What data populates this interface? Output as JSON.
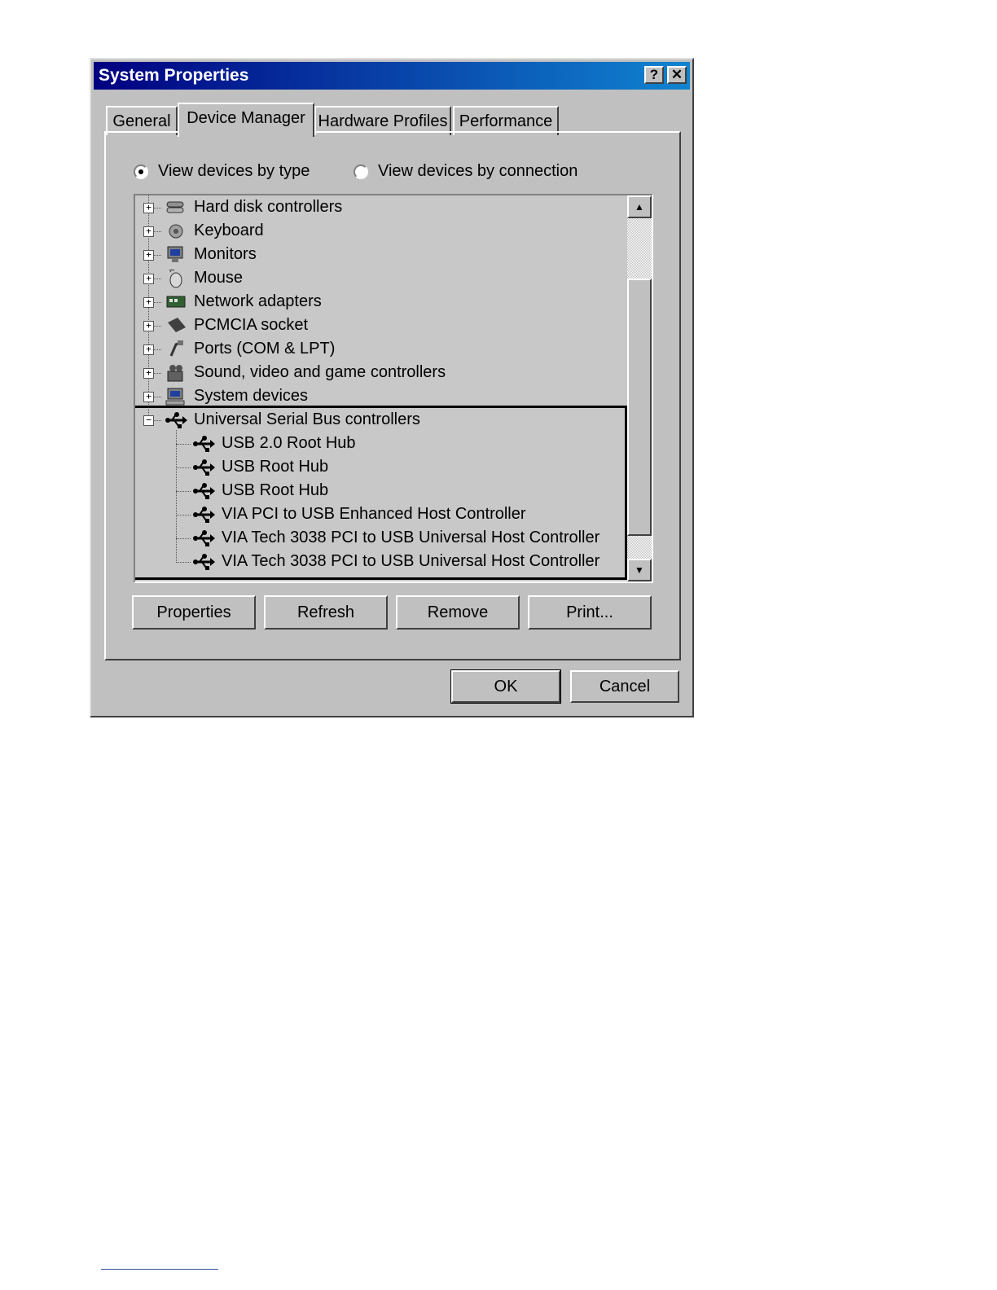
{
  "window": {
    "title": "System Properties",
    "help_label": "?",
    "close_label": "✕"
  },
  "tabs": [
    {
      "label": "General"
    },
    {
      "label": "Device Manager",
      "active": true
    },
    {
      "label": "Hardware Profiles"
    },
    {
      "label": "Performance"
    }
  ],
  "view": {
    "by_type": "View devices by type",
    "by_connection": "View devices by connection",
    "selected": "by_type"
  },
  "tree": {
    "categories": [
      {
        "label": "Hard disk controllers",
        "icon": "hard-disk-controller-icon",
        "expander": "+"
      },
      {
        "label": "Keyboard",
        "icon": "keyboard-icon",
        "expander": "+"
      },
      {
        "label": "Monitors",
        "icon": "monitor-icon",
        "expander": "+"
      },
      {
        "label": "Mouse",
        "icon": "mouse-icon",
        "expander": "+"
      },
      {
        "label": "Network adapters",
        "icon": "network-adapter-icon",
        "expander": "+"
      },
      {
        "label": "PCMCIA socket",
        "icon": "pcmcia-socket-icon",
        "expander": "+"
      },
      {
        "label": "Ports (COM & LPT)",
        "icon": "port-icon",
        "expander": "+"
      },
      {
        "label": "Sound, video and game controllers",
        "icon": "sound-icon",
        "expander": "+"
      },
      {
        "label": "System devices",
        "icon": "system-devices-icon",
        "expander": "+"
      },
      {
        "label": "Universal Serial Bus controllers",
        "icon": "usb-icon",
        "expander": "−"
      }
    ],
    "usb_children": [
      {
        "label": "USB 2.0 Root Hub",
        "icon": "usb-icon"
      },
      {
        "label": "USB Root Hub",
        "icon": "usb-icon"
      },
      {
        "label": "USB Root Hub",
        "icon": "usb-icon"
      },
      {
        "label": "VIA PCI to USB Enhanced Host Controller",
        "icon": "usb-icon"
      },
      {
        "label": "VIA Tech 3038 PCI to USB Universal Host Controller",
        "icon": "usb-icon"
      },
      {
        "label": "VIA Tech 3038 PCI to USB Universal Host Controller",
        "icon": "usb-icon"
      }
    ]
  },
  "actions": {
    "properties": "Properties",
    "refresh": "Refresh",
    "remove": "Remove",
    "print": "Print..."
  },
  "dialog": {
    "ok": "OK",
    "cancel": "Cancel"
  }
}
